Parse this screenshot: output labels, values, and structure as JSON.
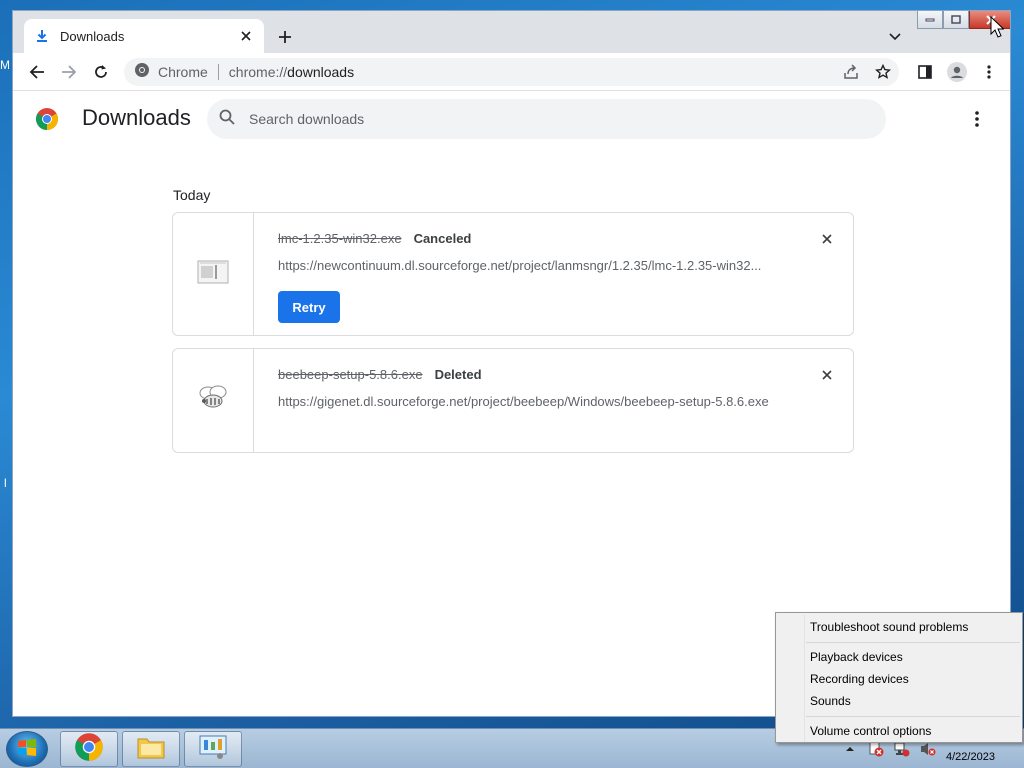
{
  "desktop": {
    "edge_text_1": "M",
    "edge_text_2": "l"
  },
  "browser": {
    "tab": {
      "title": "Downloads"
    },
    "omnibox": {
      "site_label": "Chrome",
      "url_scheme": "chrome://",
      "url_path": "downloads"
    }
  },
  "page": {
    "title": "Downloads",
    "search_placeholder": "Search downloads",
    "date_heading": "Today",
    "downloads": [
      {
        "file_name": "lmc-1.2.35-win32.exe",
        "status": "Canceled",
        "url": "https://newcontinuum.dl.sourceforge.net/project/lanmsngr/1.2.35/lmc-1.2.35-win32...",
        "action_label": "Retry"
      },
      {
        "file_name": "beebeep-setup-5.8.6.exe",
        "status": "Deleted",
        "url": "https://gigenet.dl.sourceforge.net/project/beebeep/Windows/beebeep-setup-5.8.6.exe"
      }
    ]
  },
  "context_menu": {
    "items": [
      "Troubleshoot sound problems",
      "Playback devices",
      "Recording devices",
      "Sounds",
      "Volume control options"
    ]
  },
  "taskbar": {
    "date": "4/22/2023"
  },
  "colors": {
    "accent": "#1a73e8",
    "tabstrip": "#dee1e6",
    "taskbar": "#b7cde3"
  }
}
